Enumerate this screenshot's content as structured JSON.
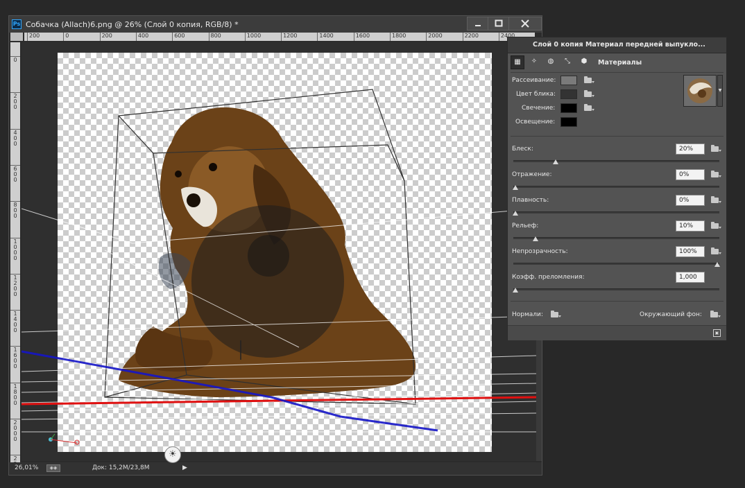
{
  "document": {
    "app_icon_label": "Ps",
    "title": "Собачка (Allach)6.png @ 26% (Слой 0 копия, RGB/8) *",
    "zoom": "26,01%",
    "doc_size": "Док: 15,2M/23,8M",
    "ruler_h_labels": [
      "200",
      "0",
      "200",
      "400",
      "600",
      "800",
      "1000",
      "1200",
      "1400",
      "1600",
      "1800",
      "2000",
      "2200",
      "2400"
    ],
    "ruler_v_labels": [
      "0",
      "200",
      "400",
      "600",
      "800",
      "1000",
      "1200",
      "1400",
      "1600",
      "1800",
      "2000",
      "2200"
    ]
  },
  "window_buttons": {
    "minimize": "minimize-icon",
    "maximize": "maximize-icon",
    "close": "close-icon"
  },
  "properties_panel": {
    "title": "Слой 0 копия Материал передней выпукло...",
    "tabs": [
      "mesh-icon",
      "deform-icon",
      "cap-icon",
      "coordinates-icon",
      "materials-icon"
    ],
    "active_tab_label": "Материалы",
    "colors": [
      {
        "label": "Рассеивание:",
        "color": "#7a7a7a"
      },
      {
        "label": "Цвет блика:",
        "color": "#333333"
      },
      {
        "label": "Свечение:",
        "color": "#000000"
      },
      {
        "label": "Освещение:",
        "color": "#000000"
      }
    ],
    "sliders": [
      {
        "label": "Блеск:",
        "value": "20%",
        "level": 0.2
      },
      {
        "label": "Отражение:",
        "value": "0%",
        "level": 0.0
      },
      {
        "label": "Плавность:",
        "value": "0%",
        "level": 0.0
      },
      {
        "label": "Рельеф:",
        "value": "10%",
        "level": 0.1
      },
      {
        "label": "Непрозрачность:",
        "value": "100%",
        "level": 1.0
      },
      {
        "label": "Коэфф. преломления:",
        "value": "1,000",
        "level": 0.0
      }
    ],
    "normals_label": "Нормали:",
    "environment_label": "Окружающий фон:"
  }
}
